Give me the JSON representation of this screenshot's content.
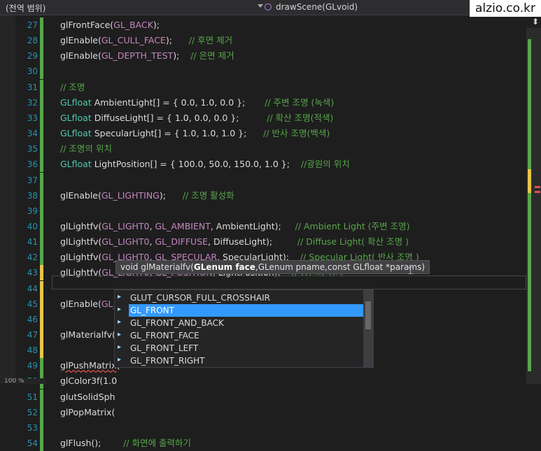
{
  "navbar": {
    "scope": "(전역 범위)",
    "function": "drawScene(GLvoid)"
  },
  "watermark": "alzio.co.kr",
  "zoom": "100 %",
  "lines": [
    {
      "n": "27",
      "parts": [
        [
          "t",
          "glFrontFace("
        ],
        [
          "m",
          "GL_BACK"
        ],
        [
          "t",
          ");"
        ]
      ]
    },
    {
      "n": "28",
      "parts": [
        [
          "t",
          "glEnable("
        ],
        [
          "m",
          "GL_CULL_FACE"
        ],
        [
          "t",
          ");      "
        ],
        [
          "c",
          "// 후면 제거"
        ]
      ]
    },
    {
      "n": "29",
      "parts": [
        [
          "t",
          "glEnable("
        ],
        [
          "m",
          "GL_DEPTH_TEST"
        ],
        [
          "t",
          ");    "
        ],
        [
          "c",
          "// 은면 제거"
        ]
      ]
    },
    {
      "n": "30",
      "parts": []
    },
    {
      "n": "31",
      "parts": [
        [
          "c",
          "// 조명"
        ]
      ]
    },
    {
      "n": "32",
      "parts": [
        [
          "k",
          "GLfloat"
        ],
        [
          "t",
          " AmbientLight[] = { 0.0, 1.0, 0.0 };       "
        ],
        [
          "c",
          "// 주변 조명 (녹색)"
        ]
      ]
    },
    {
      "n": "33",
      "parts": [
        [
          "k",
          "GLfloat"
        ],
        [
          "t",
          " DiffuseLight[] = { 1.0, 0.0, 0.0 };          "
        ],
        [
          "c",
          "// 확산 조명(적색)"
        ]
      ]
    },
    {
      "n": "34",
      "parts": [
        [
          "k",
          "GLfloat"
        ],
        [
          "t",
          " SpecularLight[] = { 1.0, 1.0, 1.0 };      "
        ],
        [
          "c",
          "// 반사 조명(백색)"
        ]
      ]
    },
    {
      "n": "35",
      "parts": [
        [
          "c",
          "// 조명의 위치"
        ]
      ]
    },
    {
      "n": "36",
      "parts": [
        [
          "k",
          "GLfloat"
        ],
        [
          "t",
          " LightPosition[] = { 100.0, 50.0, 150.0, 1.0 };    "
        ],
        [
          "c",
          "//광원의 위치"
        ]
      ]
    },
    {
      "n": "37",
      "parts": []
    },
    {
      "n": "38",
      "parts": [
        [
          "t",
          "glEnable("
        ],
        [
          "m",
          "GL_LIGHTING"
        ],
        [
          "t",
          ");      "
        ],
        [
          "c",
          "// 조명 활성화"
        ]
      ]
    },
    {
      "n": "39",
      "parts": []
    },
    {
      "n": "40",
      "parts": [
        [
          "t",
          "glLightfv("
        ],
        [
          "m",
          "GL_LIGHT0"
        ],
        [
          "t",
          ", "
        ],
        [
          "m",
          "GL_AMBIENT"
        ],
        [
          "t",
          ", AmbientLight);     "
        ],
        [
          "c",
          "// Ambient Light (주변 조명)"
        ]
      ]
    },
    {
      "n": "41",
      "parts": [
        [
          "t",
          "glLightfv("
        ],
        [
          "m",
          "GL_LIGHT0"
        ],
        [
          "t",
          ", "
        ],
        [
          "m",
          "GL_DIFFUSE"
        ],
        [
          "t",
          ", DiffuseLight);         "
        ],
        [
          "c",
          "// Diffuse Light( 확산 조명 )"
        ]
      ]
    },
    {
      "n": "42",
      "parts": [
        [
          "t",
          "glLightfv("
        ],
        [
          "m",
          "GL_LIGHT0"
        ],
        [
          "t",
          ", "
        ],
        [
          "m",
          "GL_SPECULAR"
        ],
        [
          "t",
          ", SpecularLight);    "
        ],
        [
          "c",
          "// Specular Light( 반사 조명 )"
        ]
      ]
    },
    {
      "n": "43",
      "parts": [
        [
          "t",
          "glLightfv("
        ],
        [
          "m",
          "GL_LIGHT0"
        ],
        [
          "t",
          ", "
        ],
        [
          "m",
          "GL_POSITION"
        ],
        [
          "t",
          ", LightPosition);    "
        ],
        [
          "c",
          "// 광원의 위치"
        ]
      ]
    },
    {
      "n": "44",
      "parts": []
    },
    {
      "n": "45",
      "parts": [
        [
          "t",
          "glEnable("
        ],
        [
          "m",
          "GL_LIGHT0"
        ],
        [
          "t",
          ");"
        ]
      ]
    },
    {
      "n": "46",
      "parts": []
    },
    {
      "n": "47",
      "parts": [
        [
          "t",
          "glMaterialfv(GL_fro"
        ]
      ]
    },
    {
      "n": "48",
      "parts": []
    },
    {
      "n": "49",
      "parts": [
        [
          "s",
          "glPushMatrix"
        ],
        [
          "t",
          "("
        ]
      ]
    },
    {
      "n": "50",
      "parts": [
        [
          "t",
          "glColor3f(1.0"
        ]
      ]
    },
    {
      "n": "51",
      "parts": [
        [
          "t",
          "glutSolidSph"
        ]
      ]
    },
    {
      "n": "52",
      "parts": [
        [
          "t",
          "glPopMatrix("
        ]
      ]
    },
    {
      "n": "53",
      "parts": []
    },
    {
      "n": "54",
      "parts": [
        [
          "t",
          "glFlush();        "
        ],
        [
          "c",
          "// 화면에 출력하기"
        ]
      ]
    }
  ],
  "tooltip": {
    "prefix": "void glMaterialfv(",
    "bold": "GLenum face",
    "suffix": ",GLenum pname,const GLfloat *params)"
  },
  "autocomplete": {
    "items": [
      "GLUT_CURSOR_FULL_CROSSHAIR",
      "GL_FRONT",
      "GL_FRONT_AND_BACK",
      "GL_FRONT_FACE",
      "GL_FRONT_LEFT",
      "GL_FRONT_RIGHT"
    ],
    "selected": 1
  }
}
